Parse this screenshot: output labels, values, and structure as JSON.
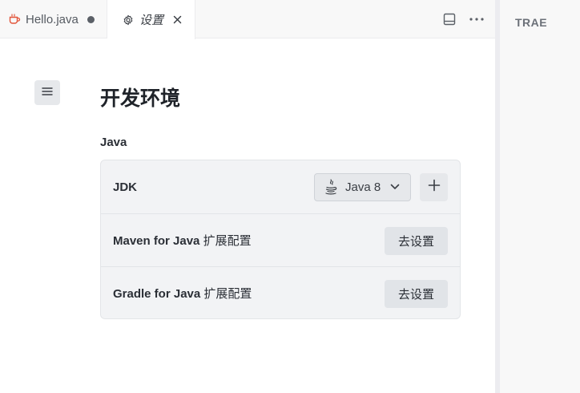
{
  "tabs": [
    {
      "label": "Hello.java",
      "icon": "java-file-icon",
      "icon_color": "#e2553a",
      "modified": true
    },
    {
      "label": "设置",
      "icon": "gear-icon",
      "active": true
    }
  ],
  "tabbar_actions": [
    "panel-layout-icon",
    "more-icon"
  ],
  "right_panel": {
    "title": "TRAE"
  },
  "settings": {
    "page_title": "开发环境",
    "section_label": "Java",
    "rows": [
      {
        "label_en": "JDK",
        "label_cn": "",
        "select_value": "Java 8",
        "select_icon": "java-cup-icon",
        "add_icon": "plus-icon"
      },
      {
        "label_en": "Maven for Java",
        "label_cn": "扩展配置",
        "button": "去设置"
      },
      {
        "label_en": "Gradle for Java",
        "label_cn": "扩展配置",
        "button": "去设置"
      }
    ]
  }
}
